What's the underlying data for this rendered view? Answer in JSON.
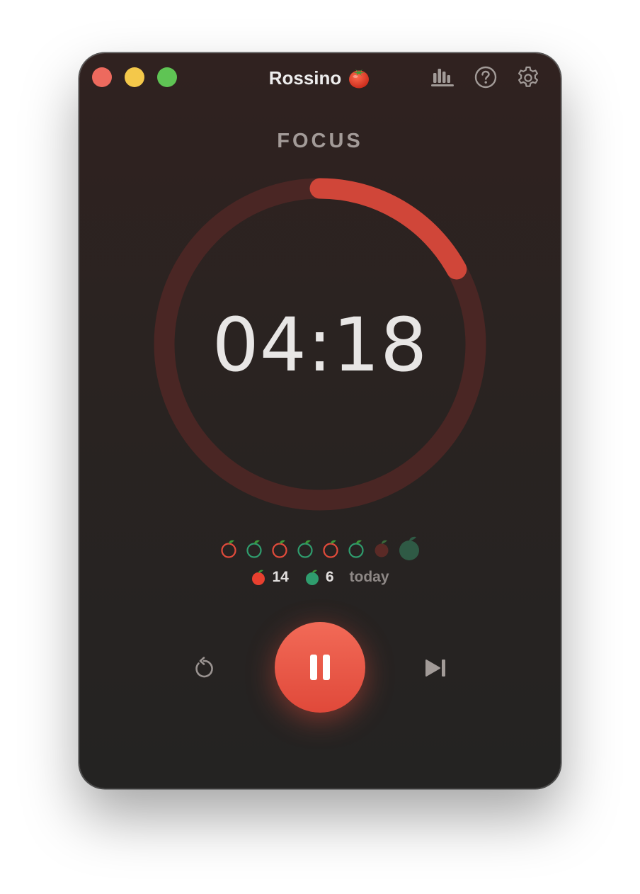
{
  "app": {
    "title": "Rossino",
    "title_emoji": "🍅"
  },
  "toolbar": {
    "stats_icon": "bar-chart-icon",
    "help_icon": "question-circle-icon",
    "settings_icon": "gear-icon"
  },
  "timer": {
    "mode": "FOCUS",
    "time": "04:18",
    "progress_fraction": 0.17
  },
  "sessions": [
    {
      "type": "focus",
      "state": "done"
    },
    {
      "type": "break",
      "state": "done"
    },
    {
      "type": "focus",
      "state": "done"
    },
    {
      "type": "break",
      "state": "done"
    },
    {
      "type": "focus",
      "state": "done"
    },
    {
      "type": "break",
      "state": "done"
    },
    {
      "type": "focus",
      "state": "current"
    },
    {
      "type": "long-break",
      "state": "upcoming"
    }
  ],
  "stats": {
    "focus_count": "14",
    "break_count": "6",
    "period": "today"
  },
  "controls": {
    "reset_icon": "reset-icon",
    "pause_icon": "pause-icon",
    "skip_icon": "skip-forward-icon"
  },
  "colors": {
    "accent": "#e24b3b",
    "break": "#2f9d6e",
    "background": "#2a2321"
  }
}
